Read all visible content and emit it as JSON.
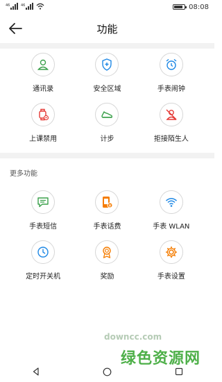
{
  "status_bar": {
    "signal_1": "⁴⁶",
    "signal_2": "⁴⁶",
    "time": "08:08",
    "battery_level": 0.85
  },
  "header": {
    "title": "功能"
  },
  "main_functions": [
    {
      "label": "通讯录",
      "icon": "contacts-icon"
    },
    {
      "label": "安全区域",
      "icon": "shield-icon"
    },
    {
      "label": "手表闹钟",
      "icon": "alarm-clock-icon"
    },
    {
      "label": "上课禁用",
      "icon": "watch-lock-icon"
    },
    {
      "label": "计步",
      "icon": "shoe-icon"
    },
    {
      "label": "拒接陌生人",
      "icon": "block-stranger-icon"
    }
  ],
  "more_section": {
    "title": "更多功能",
    "items": [
      {
        "label": "手表短信",
        "icon": "message-icon"
      },
      {
        "label": "手表话费",
        "icon": "phone-bill-icon"
      },
      {
        "label": "手表 WLAN",
        "icon": "wifi-icon"
      },
      {
        "label": "定时开关机",
        "icon": "timer-clock-icon"
      },
      {
        "label": "奖励",
        "icon": "award-icon"
      },
      {
        "label": "手表设置",
        "icon": "settings-gear-icon"
      }
    ]
  },
  "watermark": {
    "text": "绿色资源网",
    "sub": "downcc.com"
  },
  "colors": {
    "green": "#3aa04a",
    "blue": "#1e88e5",
    "red": "#e53935",
    "orange": "#f57c00",
    "band": "#f2f2f2"
  }
}
